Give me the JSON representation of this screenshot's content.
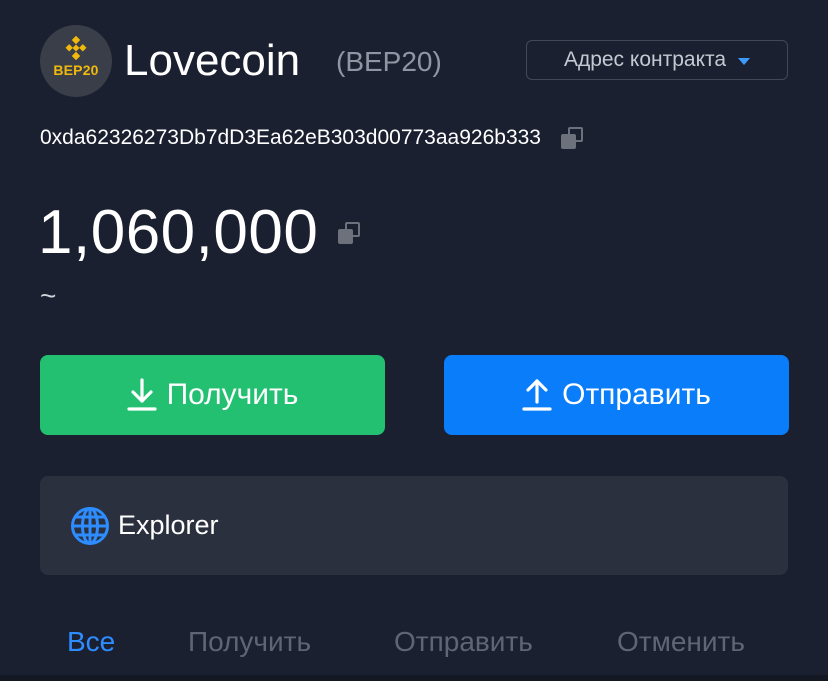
{
  "token": {
    "logo_text": "BEP20",
    "name": "Lovecoin",
    "standard": "(BEP20)",
    "address": "0xda62326273Db7dD3Ea62eB303d00773aa926b333"
  },
  "contract_menu": {
    "label": "Адрес контракта"
  },
  "balance": {
    "amount": "1,060,000",
    "fiat": "~"
  },
  "actions": {
    "receive_label": "Получить",
    "send_label": "Отправить"
  },
  "explorer": {
    "label": "Explorer"
  },
  "tabs": [
    {
      "label": "Все",
      "active": true
    },
    {
      "label": "Получить",
      "active": false
    },
    {
      "label": "Отправить",
      "active": false
    },
    {
      "label": "Отменить",
      "active": false
    }
  ],
  "colors": {
    "background": "#1b2030",
    "receive": "#23c072",
    "send": "#0a7dfb",
    "accent": "#2d8cff",
    "bnb_yellow": "#f0b90b"
  },
  "icons": {
    "logo": "bnb-icon",
    "contract": "caret-down-icon",
    "copy": "copy-icon",
    "receive": "download-icon",
    "send": "upload-icon",
    "explorer": "globe-icon"
  }
}
